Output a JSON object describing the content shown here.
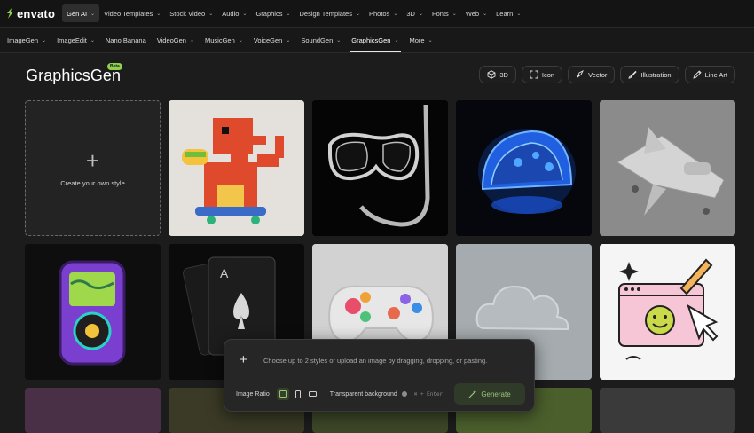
{
  "brand": {
    "name": "envato",
    "icon": "envato-leaf-icon",
    "color": "#8fd14f"
  },
  "top_nav": [
    {
      "label": "Gen AI",
      "active": true
    },
    {
      "label": "Video Templates"
    },
    {
      "label": "Stock Video"
    },
    {
      "label": "Audio"
    },
    {
      "label": "Graphics"
    },
    {
      "label": "Design Templates"
    },
    {
      "label": "Photos"
    },
    {
      "label": "3D"
    },
    {
      "label": "Fonts"
    },
    {
      "label": "Web"
    },
    {
      "label": "Learn"
    }
  ],
  "sub_nav": [
    {
      "label": "ImageGen",
      "chevron": true
    },
    {
      "label": "ImageEdit",
      "chevron": true
    },
    {
      "label": "Nano Banana",
      "chevron": false
    },
    {
      "label": "VideoGen",
      "chevron": true
    },
    {
      "label": "MusicGen",
      "chevron": true
    },
    {
      "label": "VoiceGen",
      "chevron": true
    },
    {
      "label": "SoundGen",
      "chevron": true
    },
    {
      "label": "GraphicsGen",
      "chevron": true,
      "active": true
    },
    {
      "label": "More",
      "chevron": true
    }
  ],
  "page": {
    "title": "GraphicsGen",
    "badge": "Beta"
  },
  "filters": [
    {
      "label": "3D",
      "icon": "cube-icon"
    },
    {
      "label": "Icon",
      "icon": "frame-corners-icon"
    },
    {
      "label": "Vector",
      "icon": "pen-nib-icon"
    },
    {
      "label": "Illustration",
      "icon": "brush-icon"
    },
    {
      "label": "Line Art",
      "icon": "line-art-icon"
    }
  ],
  "create_tile": {
    "label": "Create your own style"
  },
  "style_tiles": [
    {
      "subject": "voxel-dinosaur-skateboard",
      "icon": "dinosaur-icon"
    },
    {
      "subject": "glass-snorkel-mask",
      "icon": "snorkel-icon"
    },
    {
      "subject": "glowing-glass-taco",
      "icon": "taco-icon"
    },
    {
      "subject": "clay-spaceship",
      "icon": "spaceship-icon"
    },
    {
      "subject": "retro-music-player",
      "icon": "music-player-icon"
    },
    {
      "subject": "playing-cards-ace-spades",
      "icon": "cards-icon"
    },
    {
      "subject": "translucent-game-controller",
      "icon": "gamepad-icon"
    },
    {
      "subject": "glass-cloud",
      "icon": "cloud-icon"
    },
    {
      "subject": "smiley-browser-window",
      "icon": "browser-icon"
    }
  ],
  "prompt_panel": {
    "placeholder": "Choose up to 2 styles or upload an image by dragging, dropping, or pasting.",
    "aspect_label": "Image Ratio",
    "transparent_label": "Transparent background",
    "shortcut": "⌘ + Enter",
    "generate_label": "Generate"
  }
}
